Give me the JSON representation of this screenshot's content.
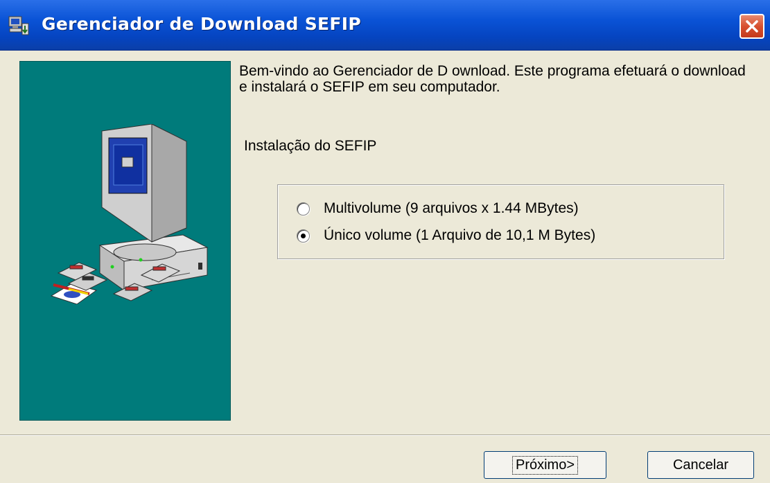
{
  "window": {
    "title": "Gerenciador de Download SEFIP"
  },
  "content": {
    "welcome_text": "Bem-vindo ao Gerenciador de D ownload. Este programa efetuará o download e instalará o SEFIP em seu computador.",
    "section_label": "Instalação do SEFIP",
    "options": [
      {
        "label": "Multivolume (9 arquivos x 1.44 MBytes)",
        "selected": false
      },
      {
        "label": "Único volume (1 Arquivo de 10,1 M Bytes)",
        "selected": true
      }
    ]
  },
  "buttons": {
    "next_label": "Próximo>",
    "cancel_label": "Cancelar"
  },
  "colors": {
    "side_panel": "#007b7b",
    "title_bar": "#0a53d6",
    "dialog_bg": "#ece9d8"
  },
  "icons": {
    "app": "download-manager-icon",
    "close": "close-icon",
    "illustration": "computer-illustration"
  }
}
